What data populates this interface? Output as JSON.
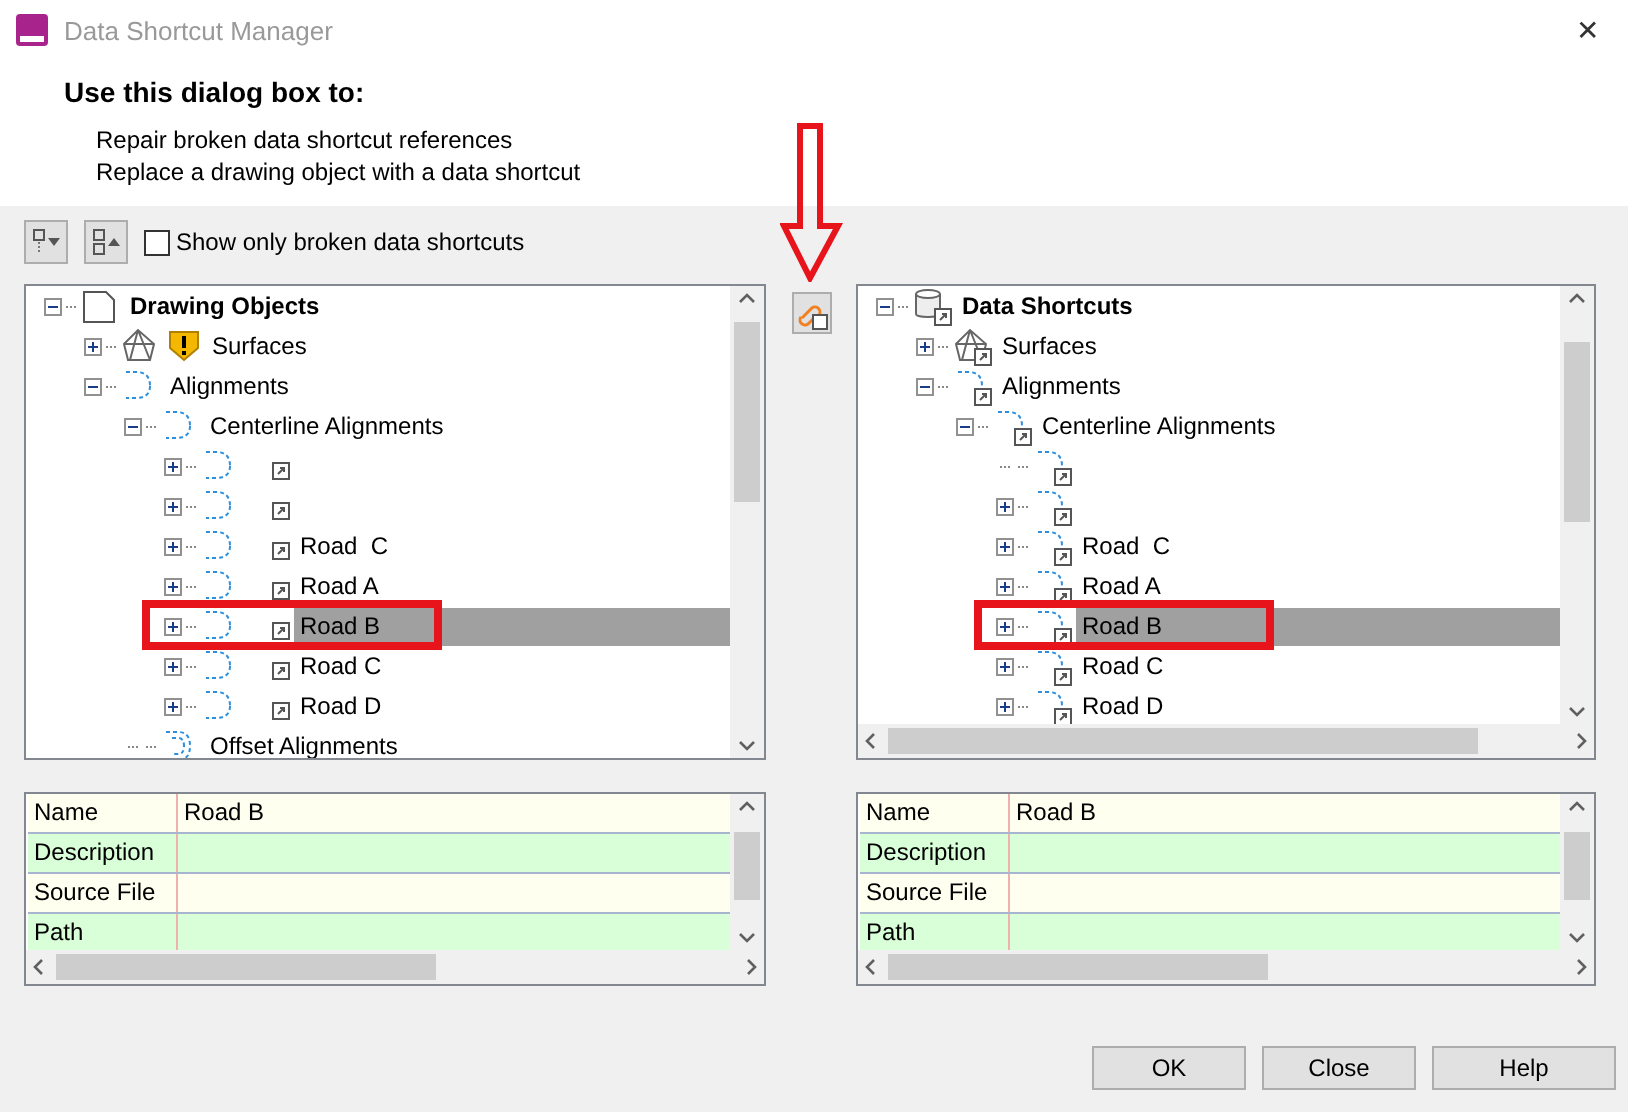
{
  "window": {
    "title": "Data Shortcut Manager",
    "close": "✕"
  },
  "header": {
    "heading": "Use this dialog box to:",
    "lines": [
      "Repair broken data shortcut references",
      "Replace a drawing object with a data shortcut"
    ]
  },
  "toolbar": {
    "broken_only": {
      "label": "Show only broken data shortcuts",
      "checked": false
    }
  },
  "arrow_annotation": true,
  "left_tree": {
    "badged": false,
    "items": [
      {
        "label": "Drawing Objects",
        "kind": "root-drawing",
        "expanded": true,
        "selected": false,
        "children": [
          {
            "label": "Surfaces",
            "kind": "surface",
            "expanded": false,
            "warning": true,
            "selected": false
          },
          {
            "label": "Alignments",
            "kind": "alignment",
            "expanded": true,
            "selected": false,
            "children": [
              {
                "label": "Centerline Alignments",
                "kind": "alignment",
                "expanded": true,
                "selected": false,
                "children": [
                  {
                    "kind": "road",
                    "expanded": false,
                    "selected": false
                  },
                  {
                    "kind": "road",
                    "expanded": false,
                    "selected": false
                  },
                  {
                    "label": "Road  C",
                    "kind": "road",
                    "expanded": false,
                    "selected": false
                  },
                  {
                    "label": "Road A",
                    "kind": "road",
                    "expanded": false,
                    "selected": false
                  },
                  {
                    "label": "Road B",
                    "kind": "road",
                    "expanded": false,
                    "selected": true,
                    "highlighted": true
                  },
                  {
                    "label": "Road C",
                    "kind": "road",
                    "expanded": false,
                    "selected": false
                  },
                  {
                    "label": "Road D",
                    "kind": "road",
                    "expanded": false,
                    "selected": false
                  }
                ]
              },
              {
                "label": "Offset Alignments",
                "kind": "offset",
                "selected": false
              }
            ]
          }
        ]
      }
    ]
  },
  "link_button": true,
  "right_tree": {
    "badged": true,
    "items": [
      {
        "label": "Data Shortcuts",
        "kind": "root-shortcuts",
        "expanded": true,
        "selected": false,
        "children": [
          {
            "label": "Surfaces",
            "kind": "surface",
            "expanded": false,
            "selected": false
          },
          {
            "label": "Alignments",
            "kind": "alignment",
            "expanded": true,
            "selected": false,
            "children": [
              {
                "label": "Centerline Alignments",
                "kind": "alignment",
                "expanded": true,
                "selected": false,
                "children": [
                  {
                    "kind": "road",
                    "selected": false
                  },
                  {
                    "kind": "road",
                    "expanded": false,
                    "selected": false
                  },
                  {
                    "label": "Road  C",
                    "kind": "road",
                    "expanded": false,
                    "selected": false
                  },
                  {
                    "label": "Road A",
                    "kind": "road",
                    "expanded": false,
                    "selected": false
                  },
                  {
                    "label": "Road B",
                    "kind": "road",
                    "expanded": false,
                    "selected": true,
                    "highlighted": true
                  },
                  {
                    "label": "Road C",
                    "kind": "road",
                    "expanded": false,
                    "selected": false
                  },
                  {
                    "label": "Road D",
                    "kind": "road",
                    "expanded": false,
                    "selected": false
                  }
                ]
              }
            ]
          }
        ]
      }
    ]
  },
  "left_properties": [
    {
      "name": "Name",
      "value": "Road B"
    },
    {
      "name": "Description"
    },
    {
      "name": "Source File"
    },
    {
      "name": "Path"
    }
  ],
  "right_properties": [
    {
      "name": "Name",
      "value": "Road B"
    },
    {
      "name": "Description"
    },
    {
      "name": "Source File"
    },
    {
      "name": "Path"
    }
  ],
  "buttons": [
    "OK",
    "Close",
    "Help"
  ]
}
